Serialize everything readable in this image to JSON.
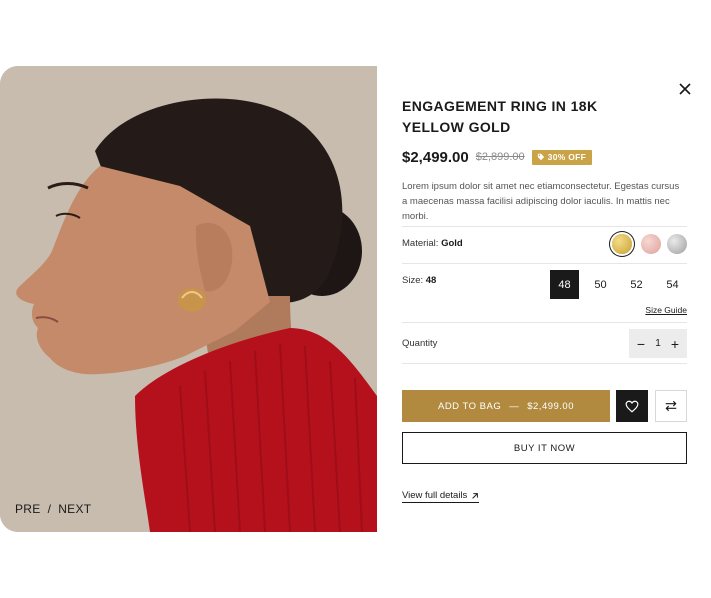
{
  "pager": {
    "prev": "PRE",
    "separator": "/",
    "next": "NEXT"
  },
  "product": {
    "title": "ENGAGEMENT RING IN 18K YELLOW GOLD",
    "price": "$2,499.00",
    "old_price": "$2,899.00",
    "discount_badge": "30% OFF",
    "description": "Lorem ipsum dolor sit amet nec etiamconsectetur. Egestas cursus a maecenas massa facilisi adipiscing dolor iaculis. In mattis nec morbi."
  },
  "material": {
    "label": "Material:",
    "selected": "Gold",
    "swatches": [
      {
        "name": "gold",
        "color": "#d6b14a"
      },
      {
        "name": "rose-gold",
        "color": "#e8b9b4"
      },
      {
        "name": "silver",
        "color": "#b9b9b9"
      }
    ]
  },
  "size": {
    "label": "Size:",
    "selected": "48",
    "options": [
      "48",
      "50",
      "52",
      "54"
    ],
    "guide_link": "Size Guide"
  },
  "quantity": {
    "label": "Quantity",
    "value": "1",
    "minus": "−",
    "plus": "+"
  },
  "actions": {
    "add_to_bag": "ADD TO BAG",
    "add_to_bag_dash": "—",
    "add_to_bag_price": "$2,499.00",
    "buy_now": "BUY IT NOW",
    "view_details": "View full details",
    "wishlist_icon": "heart-icon",
    "compare_icon": "compare-arrows-icon",
    "close_icon": "close-icon"
  },
  "colors": {
    "accent_gold": "#b18a3f",
    "badge_gold": "#c9a346",
    "dark": "#1a1a1a"
  }
}
